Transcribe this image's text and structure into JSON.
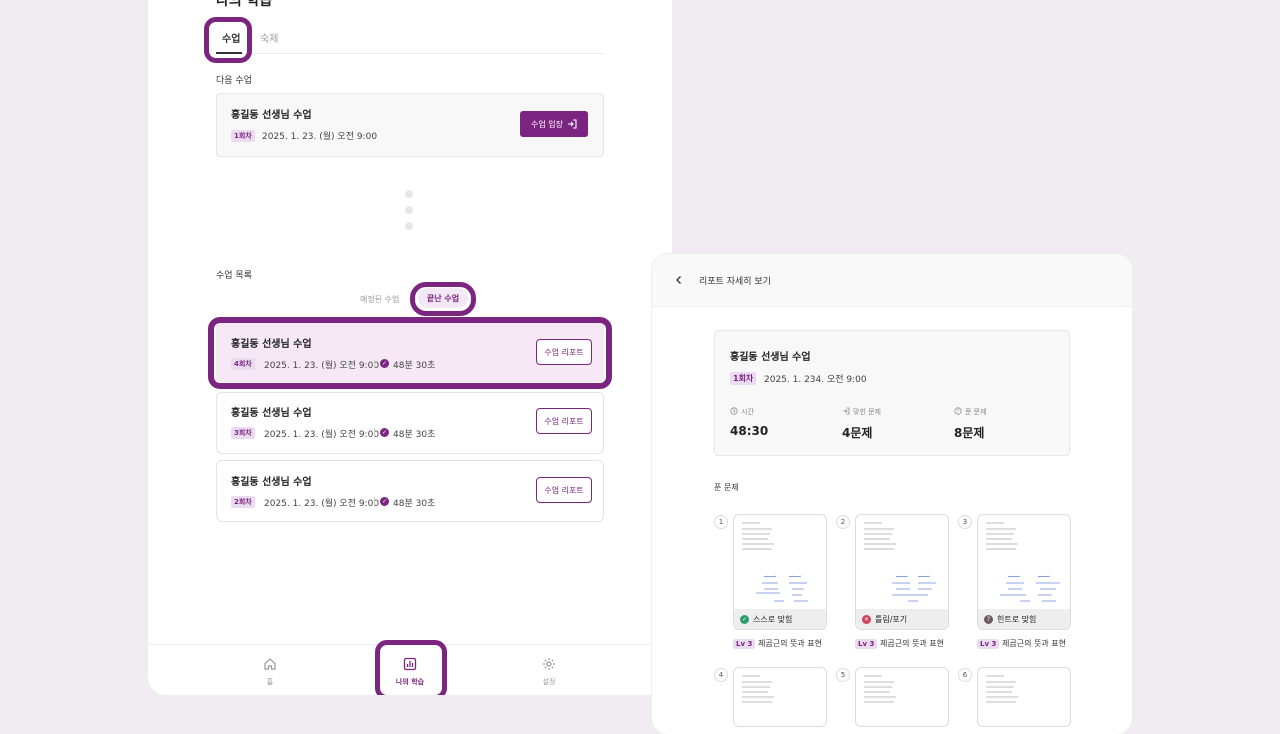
{
  "left": {
    "page_title": "나의 학습",
    "tabs": [
      "수업",
      "숙제"
    ],
    "next_section": "다음 수업",
    "next": {
      "title": "홍길동 선생님 수업",
      "round": "1회차",
      "datetime": "2025. 1. 23. (월) 오전 9:00",
      "enter_label": "수업 입장"
    },
    "list_section": "수업 목록",
    "subtabs": [
      "예정된 수업",
      "끝난 수업"
    ],
    "lessons": [
      {
        "title": "홍길동 선생님 수업",
        "round": "4회차",
        "datetime": "2025. 1. 23. (월) 오전 9:00",
        "duration": "48분 30초",
        "report": "수업 리포트"
      },
      {
        "title": "홍길동 선생님 수업",
        "round": "3회차",
        "datetime": "2025. 1. 23. (월) 오전 9:00",
        "duration": "48분 30초",
        "report": "수업 리포트"
      },
      {
        "title": "홍길동 선생님 수업",
        "round": "2회차",
        "datetime": "2025. 1. 23. (월) 오전 9:00",
        "duration": "48분 30초",
        "report": "수업 리포트"
      }
    ],
    "nav": [
      {
        "label": "홈",
        "icon": "home-icon"
      },
      {
        "label": "나의 학습",
        "icon": "chart-icon"
      },
      {
        "label": "설정",
        "icon": "gear-icon"
      }
    ]
  },
  "right": {
    "header_title": "리포트 자세히 보기",
    "summary": {
      "title": "홍길동 선생님 수업",
      "round": "1회차",
      "datetime": "2025. 1. 234. 오전 9:00",
      "stats": [
        {
          "label": "시간",
          "value": "48:30",
          "icon": "clock-icon"
        },
        {
          "label": "맞힌 문제",
          "value": "4문제",
          "icon": "enter-icon"
        },
        {
          "label": "푼 문제",
          "value": "8문제",
          "icon": "question-icon"
        }
      ]
    },
    "solved_section": "푼 문제",
    "problems": [
      {
        "num": "1",
        "status": "스스로 맞힘",
        "status_color": "#2e9d6b",
        "status_icon": "✓",
        "level": "Lv 3",
        "caption": "제곱근의 뜻과 표현"
      },
      {
        "num": "2",
        "status": "틀림/포기",
        "status_color": "#d0405c",
        "status_icon": "✕",
        "level": "Lv 3",
        "caption": "제곱근의 뜻과 표현"
      },
      {
        "num": "3",
        "status": "힌트로 맞힘",
        "status_color": "#6f5a63",
        "status_icon": "?",
        "level": "Lv 3",
        "caption": "제곱근의 뜻과 표현"
      },
      {
        "num": "4"
      },
      {
        "num": "5"
      },
      {
        "num": "6"
      }
    ]
  },
  "colors": {
    "accent": "#7b2580",
    "background": "#f1ebf2"
  }
}
